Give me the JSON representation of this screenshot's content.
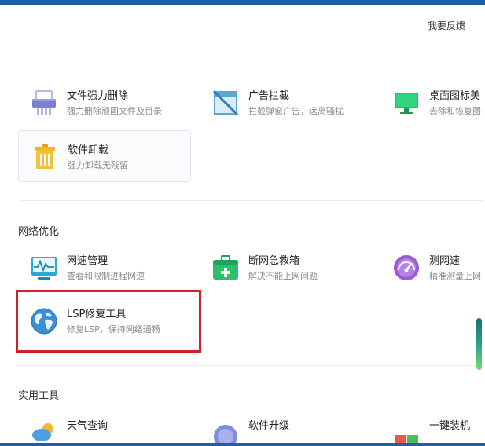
{
  "header": {
    "feedback_label": "我要反馈"
  },
  "system_tools": {
    "items": [
      {
        "title": "文件强力删除",
        "desc": "强力删除顽固文件及目录",
        "icon": "shredder-icon"
      },
      {
        "title": "广告拦截",
        "desc": "拦截弹窗广告，远离骚扰",
        "icon": "ad-block-icon"
      },
      {
        "title": "桌面图标美",
        "desc": "去除和恢复图",
        "icon": "desktop-icon"
      },
      {
        "title": "软件卸载",
        "desc": "强力卸载无残留",
        "icon": "trash-icon"
      }
    ]
  },
  "network": {
    "title": "网络优化",
    "items": [
      {
        "title": "网速管理",
        "desc": "查看和限制进程网速",
        "icon": "monitor-chart-icon"
      },
      {
        "title": "断网急救箱",
        "desc": "解决不能上网问题",
        "icon": "first-aid-kit-icon"
      },
      {
        "title": "测网速",
        "desc": "精准测量上网",
        "icon": "speedometer-icon"
      },
      {
        "title": "LSP修复工具",
        "desc": "修复LSP，保持网络通畅",
        "icon": "globe-icon"
      }
    ]
  },
  "utilities": {
    "title": "实用工具",
    "items": [
      {
        "title": "天气查询",
        "icon": "weather-icon"
      },
      {
        "title": "软件升级",
        "icon": "upgrade-icon"
      },
      {
        "title": "一键装机",
        "icon": "install-icon"
      }
    ]
  },
  "colors": {
    "accent": "#1d5fa8",
    "highlight": "#cc2229"
  }
}
